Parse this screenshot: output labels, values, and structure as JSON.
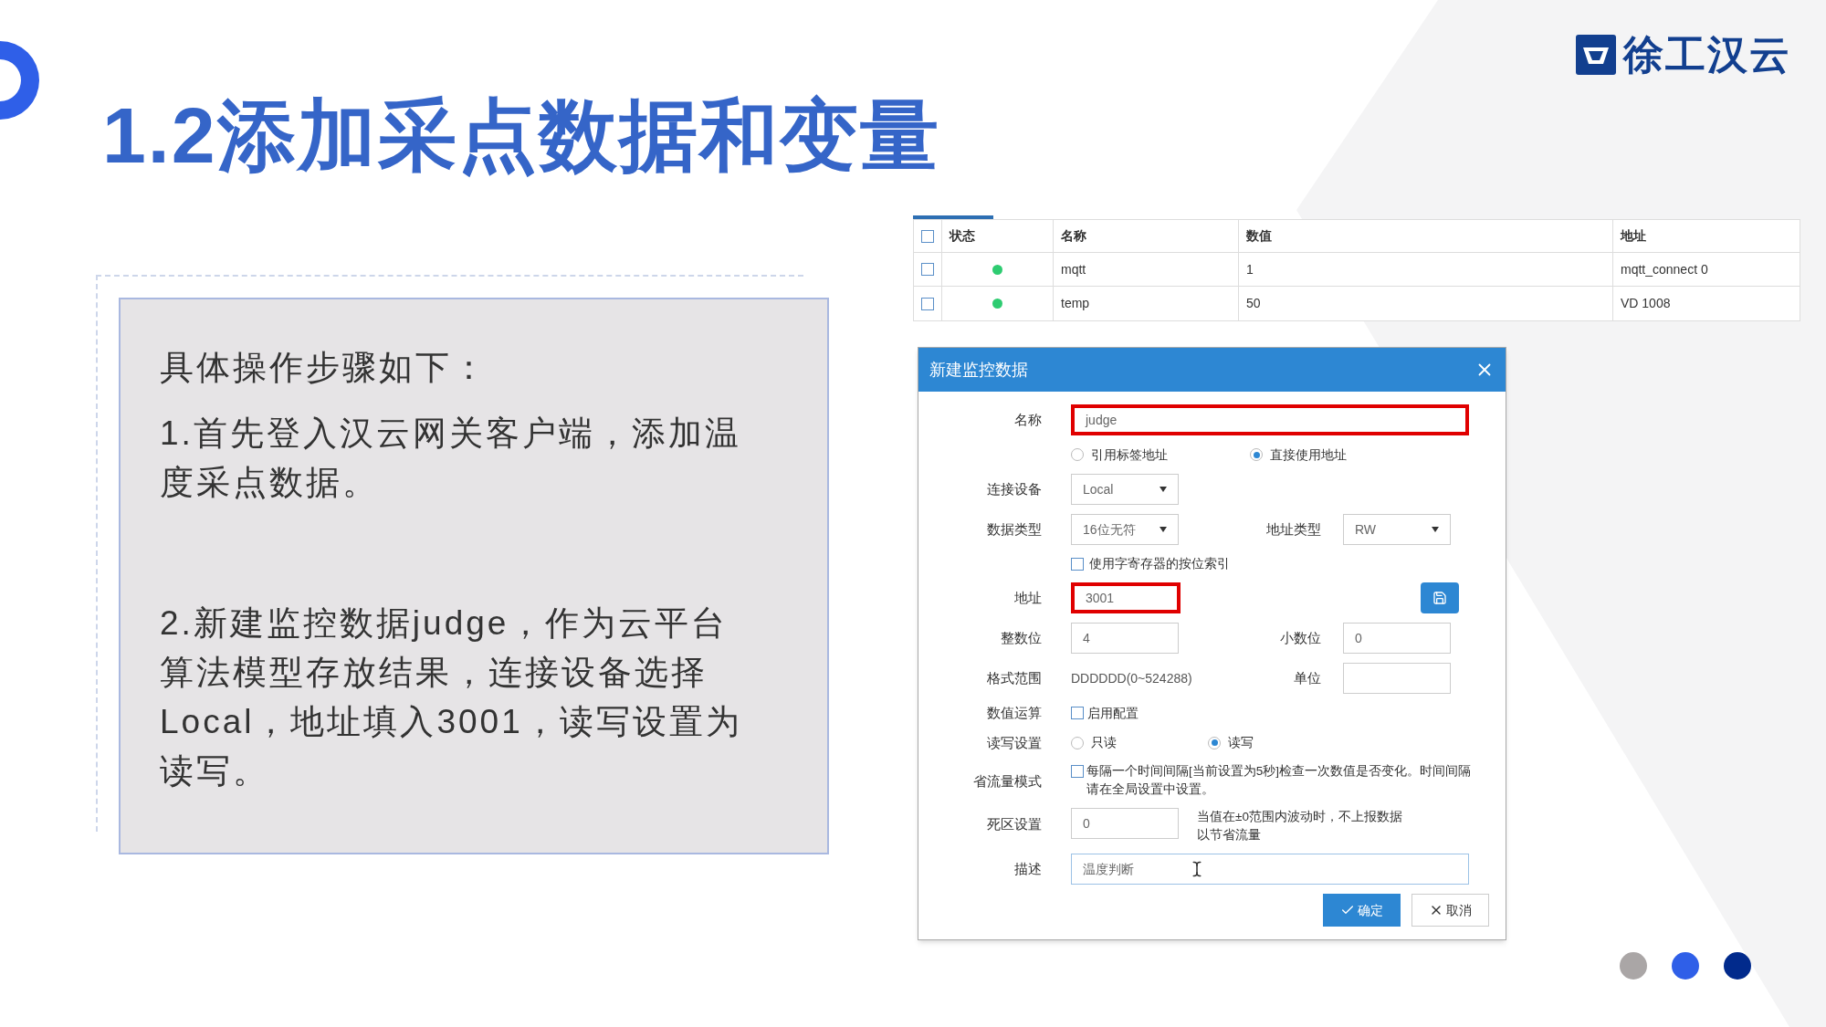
{
  "slide": {
    "title": "1.2添加采点数据和变量",
    "logo": "徐工汉云"
  },
  "instructions": [
    "具体操作步骤如下：",
    "1.首先登入汉云网关客户端，添加温度采点数据。",
    "2.新建监控数据judge，作为云平台算法模型存放结果，连接设备选择Local，地址填入3001，读写设置为读写。"
  ],
  "table": {
    "select_all": {
      "checked": false
    },
    "columns": [
      "状态",
      "名称",
      "数值",
      "地址"
    ],
    "rows": [
      {
        "selected": false,
        "color": "#2ecc71",
        "name": "mqtt",
        "value": "1",
        "address": "mqtt_connect 0"
      },
      {
        "selected": false,
        "color": "#2ecc71",
        "name": "temp",
        "value": "50",
        "address": "VD 1008"
      }
    ]
  },
  "dialog": {
    "title": "新建监控数据",
    "name": {
      "label": "名称",
      "value": "judge",
      "highlighted": true
    },
    "address_source": [
      {
        "label": "引用标签地址",
        "selected": false
      },
      {
        "label": "直接使用地址",
        "selected": true
      }
    ],
    "device": {
      "label": "连接设备",
      "value": "Local"
    },
    "data_type": {
      "label": "数据类型",
      "value": "16位无符"
    },
    "address_type": {
      "label": "地址类型",
      "value": "RW"
    },
    "bit_index": {
      "label": "使用字寄存器的按位索引",
      "checked": false
    },
    "address": {
      "label": "地址",
      "value": "3001",
      "highlighted": true
    },
    "integer_digits": {
      "label": "整数位",
      "value": "4"
    },
    "decimal_digits": {
      "label": "小数位",
      "value": "0"
    },
    "format_range": {
      "label": "格式范围",
      "value": "DDDDDD(0~524288)"
    },
    "unit": {
      "label": "单位"
    },
    "calc": {
      "label": "数值运算",
      "option": "启用配置",
      "checked": false
    },
    "rw": {
      "label": "读写设置",
      "options": [
        {
          "label": "只读",
          "selected": false
        },
        {
          "label": "读写",
          "selected": true
        }
      ]
    },
    "saving": {
      "label": "省流量模式",
      "checked": false,
      "text": "每隔一个时间间隔[当前设置为5秒]检查一次数值是否变化。时间间隔请在全局设置中设置。"
    },
    "deadband": {
      "label": "死区设置",
      "value": "0",
      "hint": "当值在±0范围内波动时，不上报数据以节省流量"
    },
    "description": {
      "label": "描述",
      "value": "温度判断"
    },
    "buttons": [
      {
        "label": "确定",
        "kind": "primary"
      },
      {
        "label": "取消",
        "kind": "secondary"
      }
    ]
  },
  "page_dots": [
    {
      "color": "#aaa6a6"
    },
    {
      "color": "#2f5fe8"
    },
    {
      "color": "#012a8c"
    }
  ]
}
